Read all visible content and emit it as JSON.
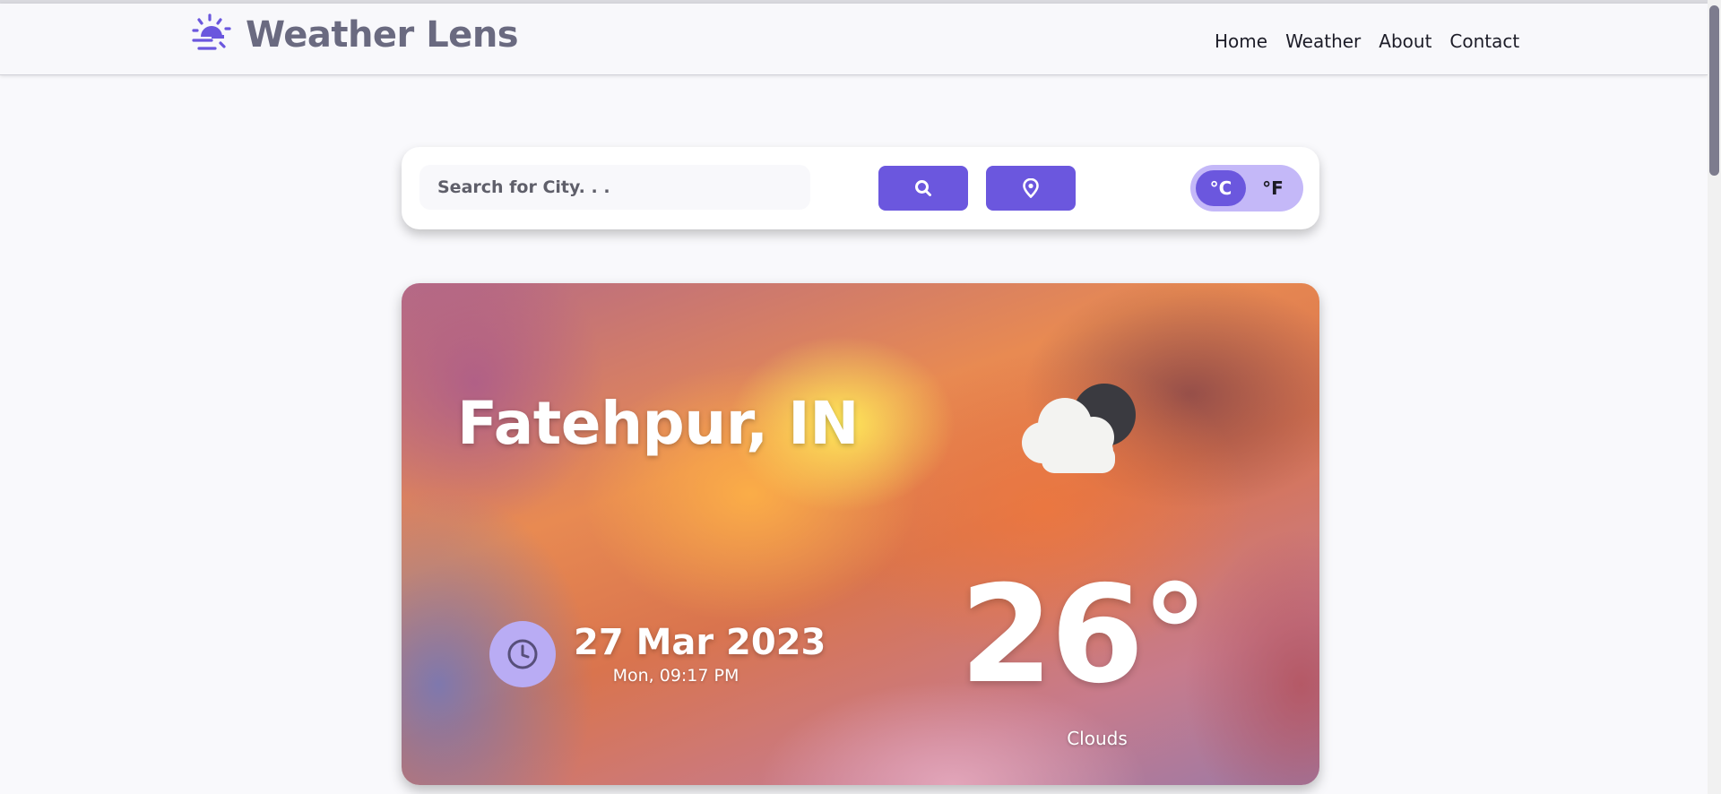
{
  "header": {
    "brand_title": "Weather Lens",
    "brand_icon": "sunrise-icon",
    "nav": [
      "Home",
      "Weather",
      "About",
      "Contact"
    ]
  },
  "search": {
    "placeholder": "Search for City. . .",
    "value": "",
    "search_icon": "search-icon",
    "location_icon": "location-pin-icon"
  },
  "units": {
    "celsius_label": "°C",
    "fahrenheit_label": "°F",
    "selected": "°C"
  },
  "weather": {
    "city": "Fatehpur, IN",
    "condition_icon": "cloud-night-icon",
    "date": "27 Mar 2023",
    "time": "Mon, 09:17 PM",
    "temperature": "26°",
    "condition": "Clouds",
    "clock_icon": "clock-icon"
  },
  "colors": {
    "accent": "#6b57de",
    "accent_light": "#c4b8f8",
    "brand_text": "#6a6a80"
  }
}
